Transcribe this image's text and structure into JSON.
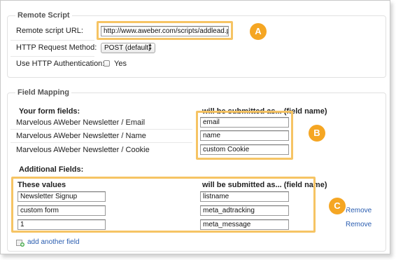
{
  "remote_script": {
    "legend": "Remote Script",
    "url_label": "Remote script URL:",
    "url_value": "http://www.aweber.com/scripts/addlead.pl",
    "method_label": "HTTP Request Method:",
    "method_value": "POST (default)",
    "auth_label": "Use HTTP Authentication:",
    "auth_checked": false,
    "auth_option": "Yes"
  },
  "field_mapping": {
    "legend": "Field Mapping",
    "your_fields_header": "Your form fields:",
    "submitted_header": "will be submitted as... (field name)",
    "rows": [
      {
        "label": "Marvelous AWeber Newsletter / Email",
        "value": "email"
      },
      {
        "label": "Marvelous AWeber Newsletter / Name",
        "value": "name"
      },
      {
        "label": "Marvelous AWeber Newsletter / Cookie",
        "value": "custom Cookie"
      }
    ],
    "additional_label": "Additional Fields:",
    "these_values_header": "These values",
    "additional_submitted_header": "will be submitted as... (field name)",
    "additional_rows": [
      {
        "value": "Newsletter Signup",
        "field": "listname",
        "action": ""
      },
      {
        "value": "custom form",
        "field": "meta_adtracking",
        "action": "Remove"
      },
      {
        "value": "1",
        "field": "meta_message",
        "action": "Remove"
      }
    ],
    "add_field_label": "add another field"
  },
  "callouts": {
    "a": "A",
    "b": "B",
    "c": "C",
    "color": "#f5a623",
    "border_color": "#f6c464"
  },
  "colors": {
    "link": "#2a5db0",
    "add_icon": "#4caf50"
  }
}
